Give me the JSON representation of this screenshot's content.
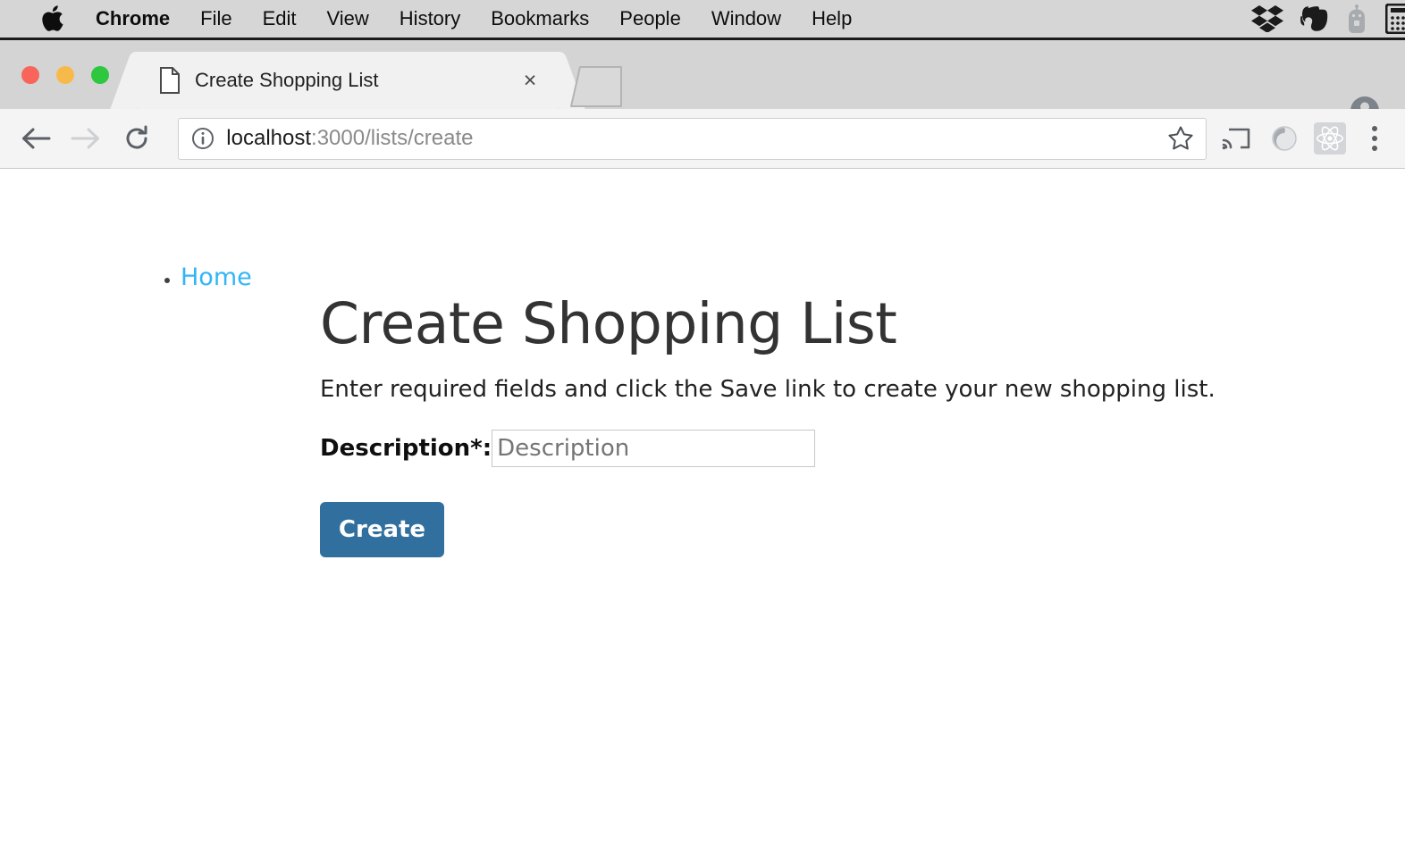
{
  "os_menubar": {
    "apple_icon": "apple-logo-icon",
    "items": [
      {
        "label": "Chrome",
        "bold": true
      },
      {
        "label": "File",
        "bold": false
      },
      {
        "label": "Edit",
        "bold": false
      },
      {
        "label": "View",
        "bold": false
      },
      {
        "label": "History",
        "bold": false
      },
      {
        "label": "Bookmarks",
        "bold": false
      },
      {
        "label": "People",
        "bold": false
      },
      {
        "label": "Window",
        "bold": false
      },
      {
        "label": "Help",
        "bold": false
      }
    ],
    "tray_icons": [
      "dropbox-icon",
      "evernote-icon",
      "robot-icon",
      "calculator-icon"
    ]
  },
  "browser": {
    "window_controls": [
      "close-button",
      "minimize-button",
      "maximize-button"
    ],
    "tab": {
      "title": "Create Shopping List",
      "favicon": "document-icon",
      "close_label": "×"
    },
    "new_tab_label": "new-tab-button",
    "profile_icon": "account-avatar-icon",
    "nav": {
      "back": "back-arrow-icon",
      "forward": "forward-arrow-icon",
      "reload": "reload-icon"
    },
    "omnibox": {
      "info_icon": "page-info-icon",
      "host": "localhost",
      "path": ":3000/lists/create",
      "full_url": "localhost:3000/lists/create",
      "star_icon": "bookmark-star-icon"
    },
    "toolbar_icons": [
      "cast-icon",
      "circle-extension-icon",
      "react-devtools-icon"
    ],
    "menu_icon": "three-dot-menu-icon"
  },
  "page": {
    "breadcrumb": [
      {
        "label": "Home",
        "href": "home"
      }
    ],
    "title": "Create Shopping List",
    "subtitle": "Enter required fields and click the Save link to create your new shopping list.",
    "form": {
      "description_label": "Description*:",
      "description_value": "",
      "description_placeholder": "Description",
      "submit_label": "Create"
    }
  },
  "colors": {
    "link_blue": "#33b5f5",
    "button_blue": "#31709e",
    "heading_gray": "#333333",
    "menubar_gray": "#d6d6d6",
    "tabstrip_gray": "#d4d4d4",
    "toolbar_gray": "#f4f4f4"
  }
}
